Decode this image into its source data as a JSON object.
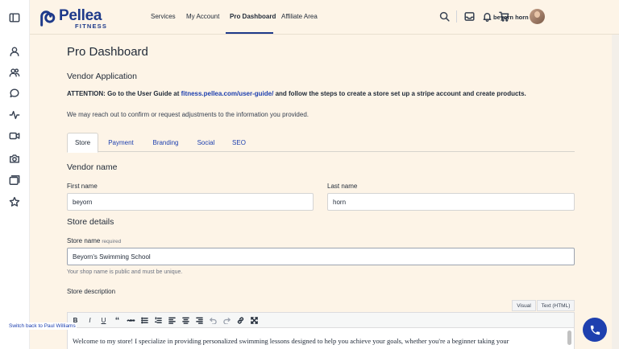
{
  "sidebar": {
    "icons": [
      "sidebar-toggle-icon",
      "user-icon",
      "users-icon",
      "chat-icon",
      "activity-icon",
      "video-icon",
      "camera-icon",
      "gallery-icon",
      "star-icon"
    ]
  },
  "header": {
    "logo_name": "Pellea",
    "logo_sub": "FITNESS",
    "nav": [
      {
        "label": "Services"
      },
      {
        "label": "My Account"
      },
      {
        "label": "Pro Dashboard",
        "active": true
      },
      {
        "label": "Affiliate Area"
      }
    ],
    "username": "beyorn horn",
    "icons": [
      "search-icon",
      "inbox-icon",
      "bell-icon",
      "cart-icon"
    ]
  },
  "page": {
    "title": "Pro Dashboard",
    "section_title": "Vendor Application",
    "attention_prefix": "ATTENTION: Go to the User Guide at ",
    "attention_link": "fitness.pellea.com/user-guide/",
    "attention_suffix": " and follow the steps to create a store set up a stripe account and create products.",
    "notice": "We may reach out to confirm or request adjustments to the information you provided."
  },
  "tabs": [
    {
      "label": "Store",
      "active": true
    },
    {
      "label": "Payment"
    },
    {
      "label": "Branding"
    },
    {
      "label": "Social"
    },
    {
      "label": "SEO"
    }
  ],
  "form": {
    "vendor_name_heading": "Vendor name",
    "first_name_label": "First name",
    "first_name_value": "beyorn",
    "last_name_label": "Last name",
    "last_name_value": "horn",
    "store_details_heading": "Store details",
    "store_name_label": "Store name",
    "store_name_required": "required",
    "store_name_value": "Beyorn's Swimming School",
    "store_name_help": "Your shop name is public and must be unique.",
    "store_description_label": "Store description",
    "editor_mode_visual": "Visual",
    "editor_mode_text": "Text (HTML)",
    "toolbar_buttons": [
      "bold-icon",
      "italic-icon",
      "underline-icon",
      "blockquote-icon",
      "strikethrough-icon",
      "bullet-list-icon",
      "numbered-list-icon",
      "align-left-icon",
      "align-center-icon",
      "align-right-icon",
      "undo-icon",
      "redo-icon",
      "link-icon",
      "fullscreen-icon"
    ],
    "toolbar_labels": {
      "b": "B",
      "i": "I",
      "u": "U",
      "quote": "“",
      "abc": "ABC"
    },
    "description_text": "Welcome to my store! I specialize in providing personalized swimming lessons designed to help you achieve your goals, whether you're a beginner taking your"
  },
  "footer": {
    "switch_back": "Switch back to Paul Williams"
  },
  "colors": {
    "accent": "#1e40af",
    "brand": "#1e3a8a",
    "background": "#fdf4e7"
  }
}
